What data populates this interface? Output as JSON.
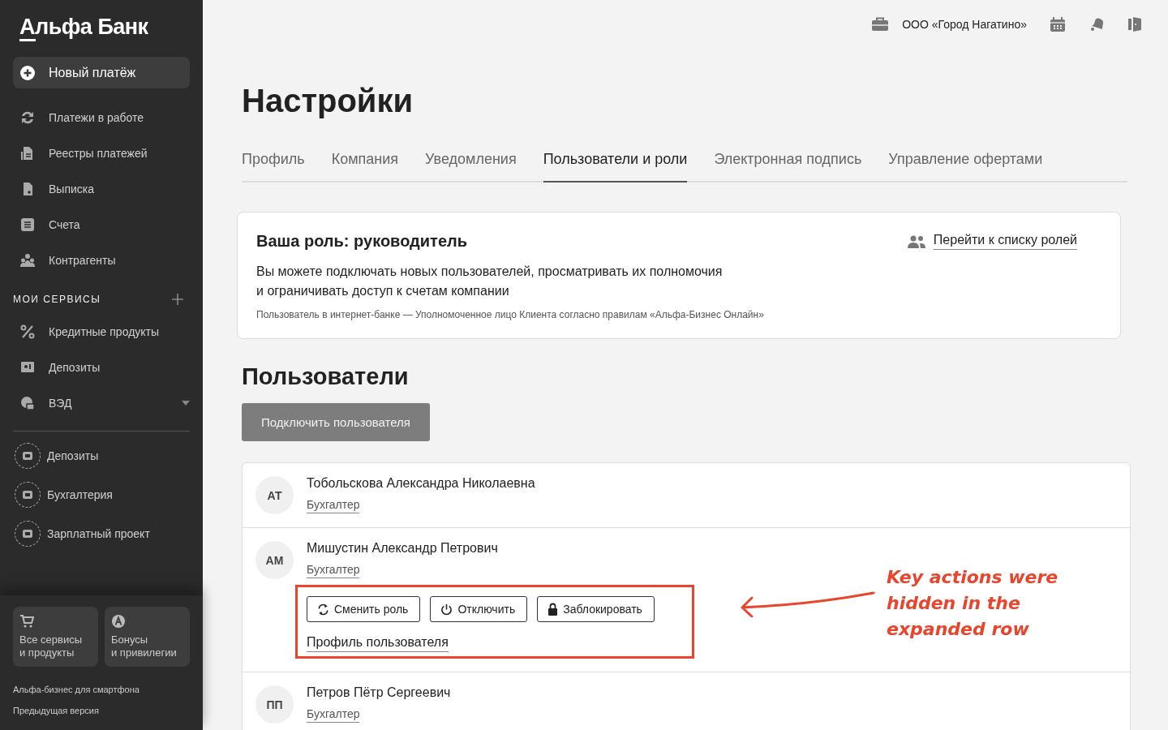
{
  "sidebar": {
    "logo": "Альфа Банк",
    "new_payment": "Новый платёж",
    "items": [
      {
        "label": "Платежи в работе"
      },
      {
        "label": "Реестры платежей"
      },
      {
        "label": "Выписка"
      },
      {
        "label": "Счета"
      },
      {
        "label": "Контрагенты"
      }
    ],
    "services_heading": "МОИ СЕРВИСЫ",
    "services": [
      {
        "label": "Кредитные продукты",
        "kind": "nav"
      },
      {
        "label": "Депозиты",
        "kind": "nav"
      },
      {
        "label": "ВЭД",
        "kind": "group"
      },
      {
        "label": "Депозиты",
        "kind": "pinned"
      },
      {
        "label": "Бухгалтерия",
        "kind": "pinned"
      },
      {
        "label": "Зарплатный проект",
        "kind": "pinned"
      }
    ],
    "tiles": [
      {
        "line1": "Все сервисы",
        "line2": "и продукты"
      },
      {
        "line1": "Бонусы",
        "line2": "и привилегии"
      }
    ],
    "links": [
      "Альфа-бизнес для смартфона",
      "Предыдущая версия"
    ]
  },
  "header": {
    "company": "ООО «Город Нагатино»"
  },
  "title": "Настройки",
  "tabs": [
    {
      "label": "Профиль",
      "selected": false
    },
    {
      "label": "Компания",
      "selected": false
    },
    {
      "label": "Уведомления",
      "selected": false
    },
    {
      "label": "Пользователи и роли",
      "selected": true
    },
    {
      "label": "Электронная подпись",
      "selected": false
    },
    {
      "label": "Управление офертами",
      "selected": false
    }
  ],
  "role_card": {
    "title": "Ваша роль: руководитель",
    "link": "Перейти к списку ролей",
    "description_lines": [
      "Вы можете подключать новых пользователей, просматривать их полномочия",
      "и ограничивать доступ к счетам компании"
    ],
    "note": "Пользователь в интернет-банке — Уполномоченное лицо Клиента согласно правилам «Альфа-Бизнес Онлайн»"
  },
  "users_heading": "Пользователи",
  "connect_button": "Подключить пользователя",
  "users": [
    {
      "initials": "АТ",
      "name": "Тобольскова Александра Николаевна",
      "role": "Бухгалтер",
      "expanded": false
    },
    {
      "initials": "АМ",
      "name": "Мишустин Александр Петрович",
      "role": "Бухгалтер",
      "expanded": true
    },
    {
      "initials": "ПП",
      "name": "Петров Пётр Сергеевич",
      "role": "Бухгалтер",
      "expanded": false
    }
  ],
  "actions": [
    {
      "label": "Сменить роль",
      "kind": "refresh"
    },
    {
      "label": "Отключить",
      "kind": "power"
    },
    {
      "label": "Заблокировать",
      "kind": "lock"
    }
  ],
  "profile_link": "Профиль пользователя",
  "annotation": {
    "text": "Key actions were hidden in the expanded row"
  }
}
